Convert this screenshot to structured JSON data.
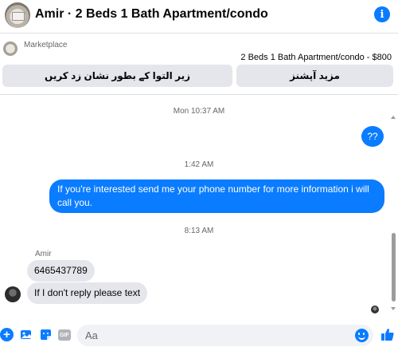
{
  "header": {
    "title": "Amir · 2 Beds 1 Bath Apartment/condo",
    "info_icon": "i"
  },
  "marketplace": {
    "label": "Marketplace",
    "listing": "2 Beds 1 Bath Apartment/condo - $800",
    "mark_pending_label": "زیر التوا کے بطور نشان زد کریں",
    "more_options_label": "مزید آپشنز"
  },
  "conversation": {
    "timestamps": [
      "Mon 10:37 AM",
      "1:42 AM",
      "8:13 AM"
    ],
    "outgoing": [
      {
        "text": "??"
      },
      {
        "text": "If you're interested send me your phone number for more information i will call you."
      }
    ],
    "sender_name": "Amir",
    "incoming": [
      {
        "text": "6465437789"
      },
      {
        "text": "If I don't reply please text"
      }
    ]
  },
  "composer": {
    "placeholder": "Aa",
    "gif_label": "GIF",
    "plus_label": "+"
  },
  "colors": {
    "accent": "#0a7cff",
    "bubble_incoming": "#e4e6eb",
    "muted_text": "#65676b"
  },
  "icons": [
    "info-icon",
    "plus-icon",
    "image-icon",
    "sticker-icon",
    "gif-icon",
    "emoji-icon",
    "like-icon"
  ]
}
